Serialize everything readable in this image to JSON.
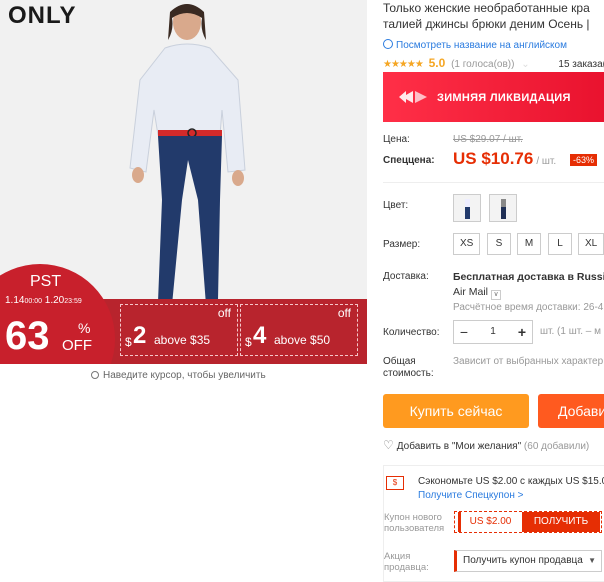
{
  "brand": "ONLY",
  "promo": {
    "title": "PST",
    "date_start": "1.14",
    "time_start": "00:00",
    "date_end": "1.20",
    "time_end": "23:59",
    "percent": "63",
    "percent_sign": "%",
    "off": "OFF",
    "coupons": [
      {
        "currency": "$",
        "amount": "2",
        "condition": "above $35",
        "off": "off"
      },
      {
        "currency": "$",
        "amount": "4",
        "condition": "above $50",
        "off": "off"
      }
    ]
  },
  "zoom_hint": "Наведите курсор, чтобы увеличить",
  "product": {
    "title_line1": "Только женские необработанные кра",
    "title_line2": "талией джинсы брюки деним Осень |",
    "translate_link": "Посмотреть название на английском",
    "stars": "★★★★★",
    "rating": "5.0",
    "votes": "(1 голоса(ов))",
    "orders": "15 заказа(о"
  },
  "banner": {
    "text": "ЗИМНЯЯ ЛИКВИДАЦИЯ"
  },
  "price": {
    "label": "Цена:",
    "old": "US $29.07 / шт.",
    "special_label": "Спеццена:",
    "new": "US $10.76",
    "unit": "/ шт.",
    "discount": "-63%"
  },
  "color": {
    "label": "Цвет:"
  },
  "size": {
    "label": "Размер:",
    "options": [
      "XS",
      "S",
      "M",
      "L",
      "XL"
    ]
  },
  "shipping": {
    "label": "Доставка:",
    "line1": "Бесплатная доставка в Russian",
    "line2": "Air Mail",
    "time": "Расчётное время доставки: 26-4"
  },
  "quantity": {
    "label": "Количество:",
    "minus": "−",
    "value": "1",
    "plus": "+",
    "unit": "шт. (1 шт. – м"
  },
  "total": {
    "label_line1": "Общая",
    "label_line2": "стоимость:",
    "value": "Зависит от выбранных характер"
  },
  "buttons": {
    "buy": "Купить сейчас",
    "cart": "Добави"
  },
  "wishlist": {
    "label": "Добавить в \"Мои желания\"",
    "count": "(60 добавили)"
  },
  "coupons": {
    "save_text": "Сэкономьте US $2.00 с каждых US $15.00",
    "get_special": "Получите Спецкупон >",
    "new_user_label_1": "Купон нового",
    "new_user_label_2": "пользователя",
    "new_user_amount": "US $2.00",
    "get_button": "ПОЛУЧИТЬ",
    "seller_label_1": "Акция",
    "seller_label_2": "продавца:",
    "seller_select": "Получить купон продавца"
  },
  "colors": {
    "accent": "#e62e04",
    "buy": "#ff9a1f",
    "cart": "#ff5a1f",
    "banner": "#ff2f47",
    "promo_red": "#c8202c",
    "link": "#2a7bdf",
    "star": "#f5a623"
  }
}
